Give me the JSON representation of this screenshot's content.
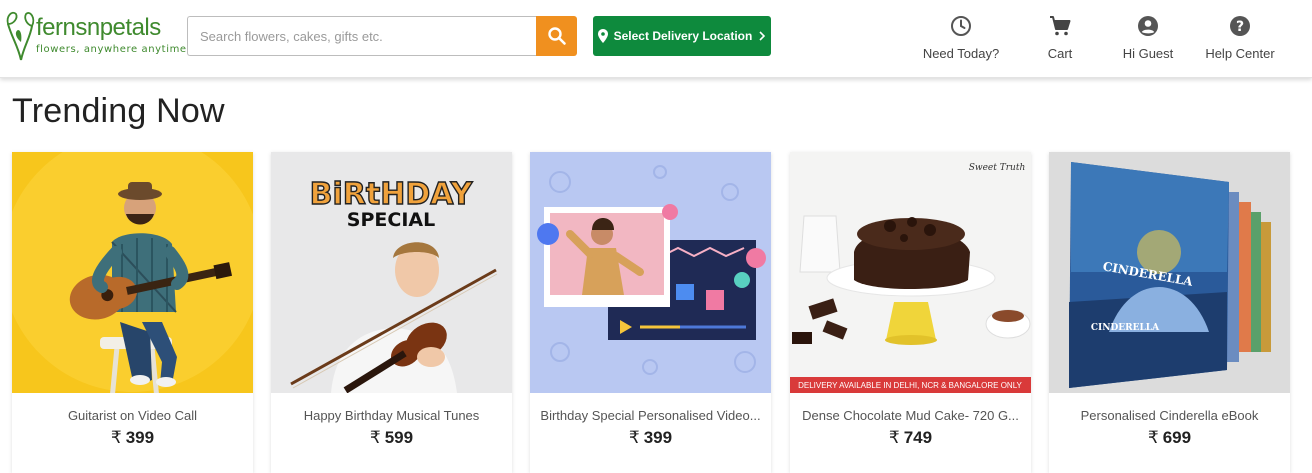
{
  "brand": {
    "name": "fernsnpetals",
    "tagline": "flowers, anywhere anytime...",
    "color": "#3f8a2e"
  },
  "search": {
    "placeholder": "Search flowers, cakes, gifts etc.",
    "button_color": "#f0901f"
  },
  "location_button": {
    "label": "Select Delivery Location",
    "color": "#0e8a3d"
  },
  "nav": [
    {
      "label": "Need Today?",
      "icon": "clock-icon"
    },
    {
      "label": "Cart",
      "icon": "cart-icon"
    },
    {
      "label": "Hi Guest",
      "icon": "account-icon"
    },
    {
      "label": "Help Center",
      "icon": "help-icon"
    }
  ],
  "section": {
    "title": "Trending Now"
  },
  "products": [
    {
      "name": "Guitarist on Video Call",
      "currency": "₹",
      "price": "399"
    },
    {
      "name": "Happy Birthday Musical Tunes",
      "currency": "₹",
      "price": "599",
      "image_text": {
        "line1": "BiRtHDAY",
        "line2": "SPECIAL"
      }
    },
    {
      "name": "Birthday Special Personalised Video...",
      "currency": "₹",
      "price": "399"
    },
    {
      "name": "Dense Chocolate Mud Cake- 720 G...",
      "currency": "₹",
      "price": "749",
      "image_text": {
        "promo": "DELIVERY AVAILABLE IN DELHI, NCR & BANGALORE ONLY",
        "brand": "Sweet Truth"
      }
    },
    {
      "name": "Personalised Cinderella eBook",
      "currency": "₹",
      "price": "699",
      "image_text": {
        "book": "CINDERELLA"
      }
    }
  ]
}
